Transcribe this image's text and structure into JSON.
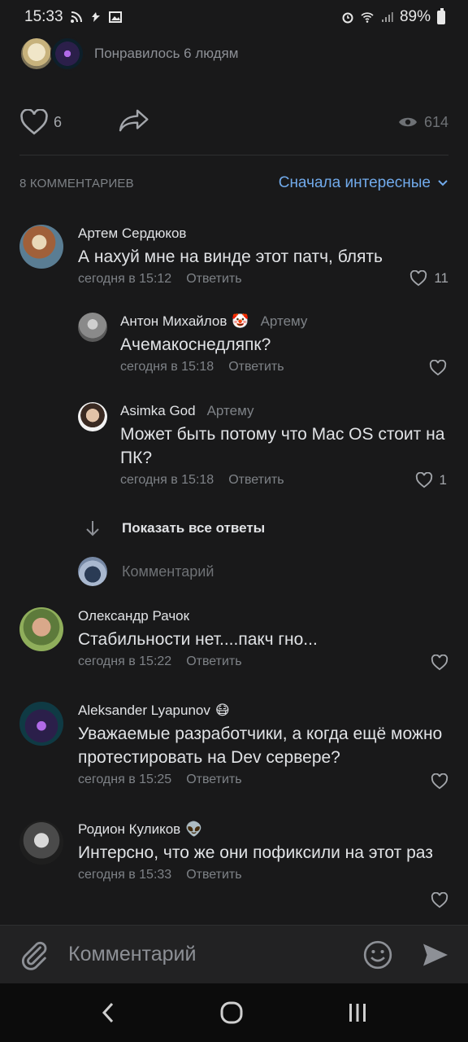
{
  "status": {
    "time": "15:33",
    "battery": "89%"
  },
  "liked": {
    "text": "Понравилось 6 людям"
  },
  "actions": {
    "likes": "6",
    "views": "614"
  },
  "comments_header": {
    "count": "8 КОММЕНТАРИЕВ",
    "sort": "Сначала интересные"
  },
  "comments": [
    {
      "name": "Артем Сердюков",
      "text": "А нахуй мне на винде этот патч, блять",
      "time": "сегодня в 15:12",
      "reply": "Ответить",
      "likes": "11"
    },
    {
      "name": "Антон Михайлов",
      "emoji": "🤡",
      "to": "Артему",
      "text": "Ачемакоснедляпк?",
      "time": "сегодня в 15:18",
      "reply": "Ответить",
      "likes": ""
    },
    {
      "name": "Asimka God",
      "to": "Артему",
      "text": "Может быть потому что Mac OS стоит на ПК?",
      "time": "сегодня в 15:18",
      "reply": "Ответить",
      "likes": "1"
    },
    {
      "name": "Олександр Рачок",
      "text": "Стабильности нет....пакч гно...",
      "time": "сегодня в 15:22",
      "reply": "Ответить",
      "likes": ""
    },
    {
      "name": "Aleksander Lyapunov",
      "emoji": "😷",
      "text": "Уважаемые разработчики, а когда ещё можно протестировать на Dev сервере?",
      "time": "сегодня в 15:25",
      "reply": "Ответить",
      "likes": ""
    },
    {
      "name": "Родион Куликов",
      "emoji": "👽",
      "text": "Интерсно, что же они пофиксили на этот раз",
      "time": "сегодня в 15:33",
      "reply": "Ответить",
      "likes": ""
    }
  ],
  "show_replies": "Показать все ответы",
  "reply_placeholder": "Комментарий",
  "composer": {
    "placeholder": "Комментарий"
  }
}
